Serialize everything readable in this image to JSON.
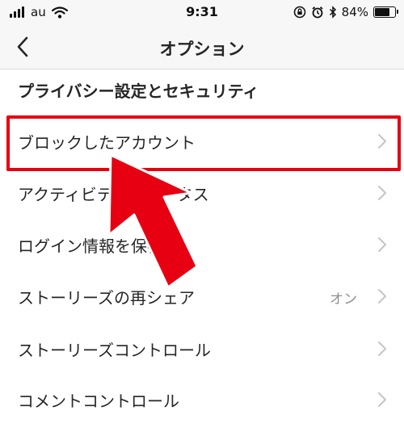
{
  "status_bar": {
    "carrier": "au",
    "time": "9:31",
    "battery_percent": "84%",
    "battery_level": 0.84
  },
  "nav": {
    "title": "オプション"
  },
  "section": {
    "title": "プライバシー設定とセキュリティ"
  },
  "menu_items": [
    {
      "label": "ブロックしたアカウント",
      "value": ""
    },
    {
      "label": "アクティビティステータス",
      "value": ""
    },
    {
      "label": "ログイン情報を保存",
      "value": ""
    },
    {
      "label": "ストーリーズの再シェア",
      "value": "オン"
    },
    {
      "label": "ストーリーズコントロール",
      "value": ""
    },
    {
      "label": "コメントコントロール",
      "value": ""
    }
  ],
  "colors": {
    "highlight": "#e60012",
    "chevron": "#c7c7cc",
    "text": "#262626",
    "secondary_text": "#8e8e8e"
  },
  "icons": {
    "back": "chevron-left-icon",
    "row": "chevron-right-icon",
    "annotation": "red-arrow-icon"
  }
}
